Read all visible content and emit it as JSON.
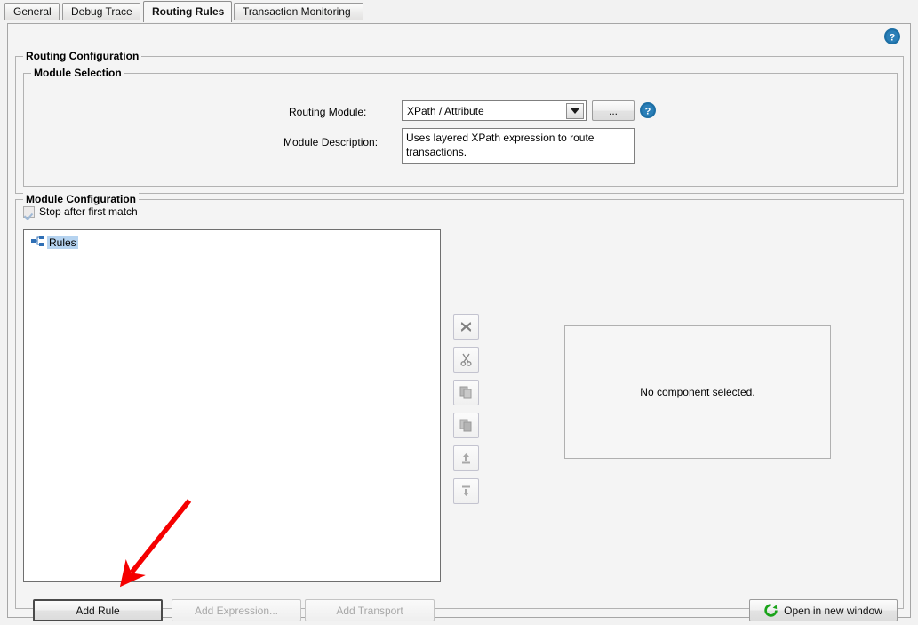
{
  "tabs": [
    {
      "label": "General",
      "active": false
    },
    {
      "label": "Debug Trace",
      "active": false
    },
    {
      "label": "Routing Rules",
      "active": true
    },
    {
      "label": "Transaction Monitoring",
      "active": false
    }
  ],
  "help_icon": "help-circle-icon",
  "routing_configuration": {
    "title": "Routing Configuration",
    "module_selection": {
      "title": "Module Selection",
      "routing_module_label": "Routing Module:",
      "routing_module_value": "XPath / Attribute",
      "browse_button_label": "...",
      "help_icon": "help-circle-icon",
      "module_description_label": "Module Description:",
      "module_description_value": "Uses layered XPath expression to route transactions."
    },
    "module_configuration": {
      "title": "Module Configuration",
      "stop_after_first_match_label": "Stop after first match",
      "stop_after_first_match_checked": true,
      "tree": {
        "root_label": "Rules",
        "root_icon": "hierarchy-icon"
      },
      "toolbar": [
        {
          "name": "delete-button",
          "icon": "delete-x-icon",
          "enabled": false
        },
        {
          "name": "cut-button",
          "icon": "scissors-icon",
          "enabled": false
        },
        {
          "name": "copy-button",
          "icon": "copy-icon",
          "enabled": false
        },
        {
          "name": "paste-button",
          "icon": "paste-icon",
          "enabled": false
        },
        {
          "name": "move-up-button",
          "icon": "arrow-up-icon",
          "enabled": false
        },
        {
          "name": "move-down-button",
          "icon": "arrow-down-icon",
          "enabled": false
        }
      ],
      "preview_message": "No component selected.",
      "buttons": {
        "add_rule": "Add Rule",
        "add_expression": "Add Expression...",
        "add_transport": "Add Transport",
        "open_in_new_window": "Open in new window",
        "open_in_new_window_icon": "green-refresh-icon"
      }
    }
  },
  "annotation": {
    "type": "red-arrow",
    "color": "#f50000",
    "points_to": "Add Rule"
  }
}
